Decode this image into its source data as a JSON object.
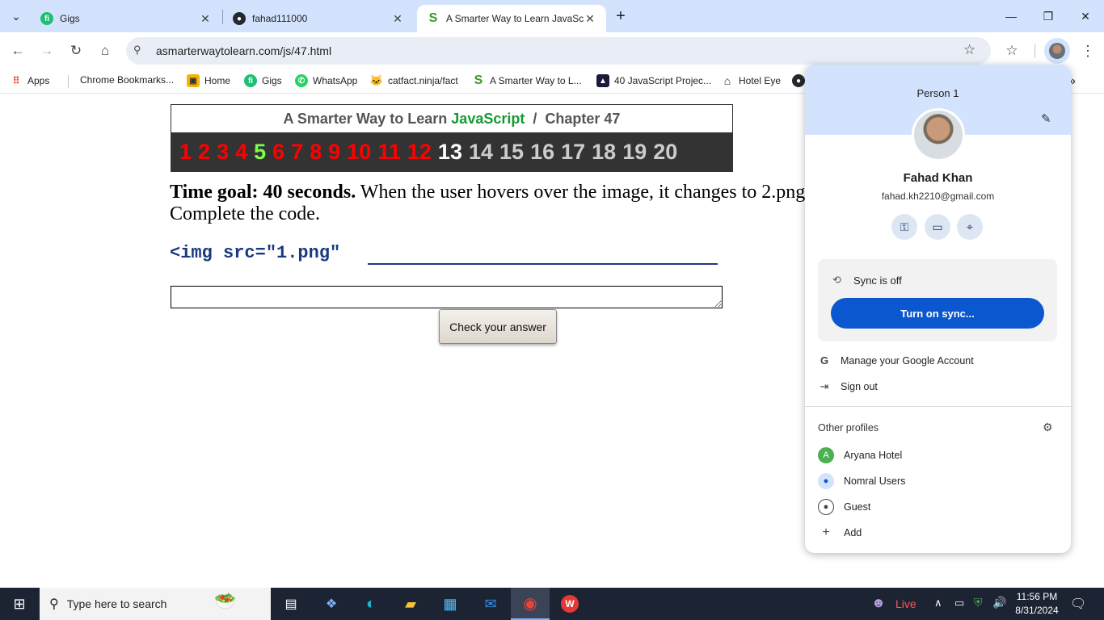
{
  "tabs": [
    {
      "title": "Gigs",
      "icon": "fiverr-icon",
      "color": "#1dbf73"
    },
    {
      "title": "fahad111000",
      "icon": "github-icon",
      "color": "#24292f"
    },
    {
      "title": "A Smarter Way to Learn JavaScr",
      "icon": "smarter-way-icon",
      "color": "#3a9b1e"
    }
  ],
  "toolbar": {
    "url": "asmarterwaytolearn.com/js/47.html"
  },
  "bookmarks": [
    {
      "label": "Apps"
    },
    {
      "label": "Chrome Bookmarks..."
    },
    {
      "label": "Home"
    },
    {
      "label": "Gigs"
    },
    {
      "label": "WhatsApp"
    },
    {
      "label": "catfact.ninja/fact"
    },
    {
      "label": "A Smarter Way to L..."
    },
    {
      "label": "40 JavaScript Projec..."
    },
    {
      "label": "Hotel Eye"
    }
  ],
  "page": {
    "heading_prefix": "A Smarter Way to Learn",
    "heading_brand": "JavaScript",
    "heading_sep": "/",
    "heading_chapter": "Chapter 47",
    "chapters": [
      {
        "n": "1",
        "color": "#ff0000"
      },
      {
        "n": "2",
        "color": "#ff0000"
      },
      {
        "n": "3",
        "color": "#ff0000"
      },
      {
        "n": "4",
        "color": "#ff0000"
      },
      {
        "n": "5",
        "color": "#7cff4a"
      },
      {
        "n": "6",
        "color": "#ff0000"
      },
      {
        "n": "7",
        "color": "#ff0000"
      },
      {
        "n": "8",
        "color": "#ff0000"
      },
      {
        "n": "9",
        "color": "#ff0000"
      },
      {
        "n": "10",
        "color": "#ff0000"
      },
      {
        "n": "11",
        "color": "#ff0000"
      },
      {
        "n": "12",
        "color": "#ff0000"
      },
      {
        "n": "13",
        "color": "#ffffff"
      },
      {
        "n": "14",
        "color": "#cccccc"
      },
      {
        "n": "15",
        "color": "#cccccc"
      },
      {
        "n": "16",
        "color": "#cccccc"
      },
      {
        "n": "17",
        "color": "#cccccc"
      },
      {
        "n": "18",
        "color": "#cccccc"
      },
      {
        "n": "19",
        "color": "#cccccc"
      },
      {
        "n": "20",
        "color": "#cccccc"
      }
    ],
    "time_goal": "Time goal: 40 seconds.",
    "question": " When the user hovers over the image, it changes to 2.png. Complete the code.",
    "code": "<img src=\"1.png\"",
    "answer_value": "",
    "check_button": "Check your answer"
  },
  "profile": {
    "person_label": "Person 1",
    "name": "Fahad Khan",
    "email": "fahad.kh2210@gmail.com",
    "sync_status": "Sync is off",
    "sync_button": "Turn on sync...",
    "manage": "Manage your Google Account",
    "sign_out": "Sign out",
    "other_profiles": "Other profiles",
    "profiles": [
      {
        "label": "Aryana Hotel",
        "initial": "A"
      },
      {
        "label": "Nomral Users"
      },
      {
        "label": "Guest"
      },
      {
        "label": "Add"
      }
    ]
  },
  "taskbar": {
    "search_placeholder": "Type here to search",
    "live": "Live",
    "time": "11:56 PM",
    "date": "8/31/2024"
  }
}
